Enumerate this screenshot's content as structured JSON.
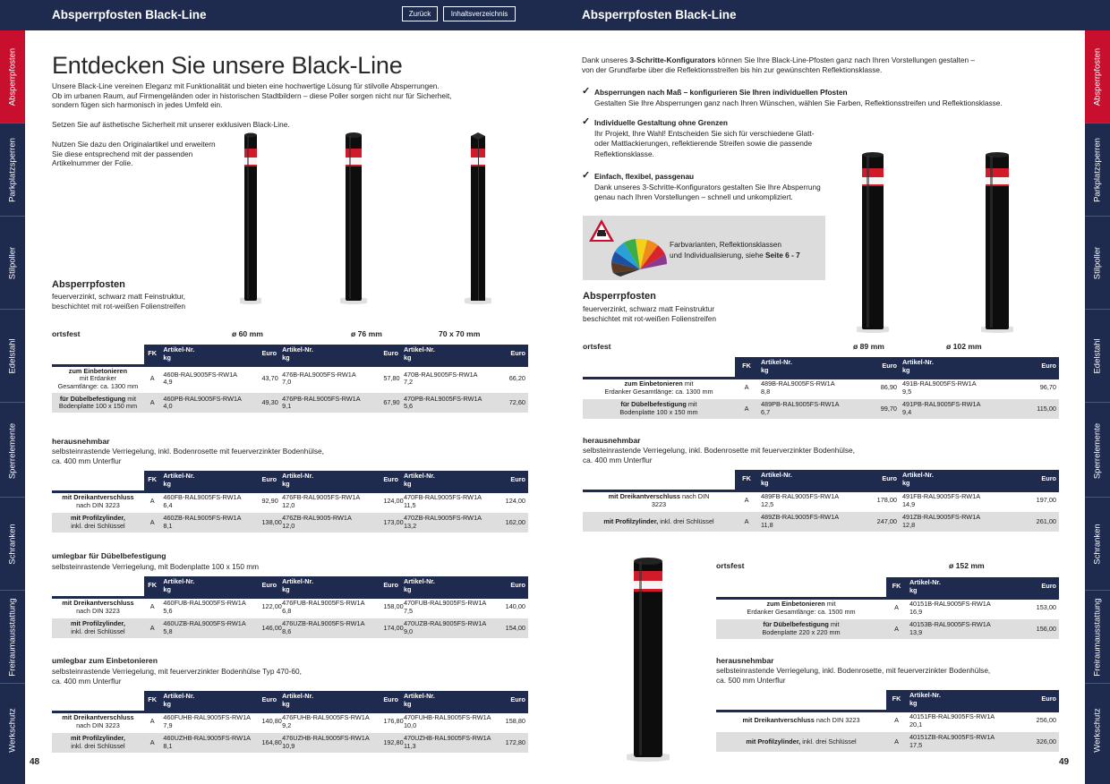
{
  "header": {
    "left_title": "Absperrpfosten Black-Line",
    "right_title": "Absperrpfosten Black-Line",
    "back_label": "Zurück",
    "toc_label": "Inhaltsverzeichnis"
  },
  "nav_tabs": [
    "Absperrpfosten",
    "Parkplatzsperren",
    "Stilpoller",
    "Edelstahl",
    "Sperrelemente",
    "Schranken",
    "Freiraumausstattung",
    "Werkschutz"
  ],
  "colors": {
    "navy": "#1e2a4e",
    "accent_red": "#c8102e"
  },
  "page_numbers": {
    "left": "48",
    "right": "49"
  },
  "left": {
    "headline": "Entdecken Sie unsere Black-Line",
    "intro": [
      "Unsere Black-Line vereinen Eleganz mit Funktionalität und bieten eine hochwertige Lösung für stilvolle Absperrungen.",
      "Ob im urbanen Raum, auf Firmengeländen oder in historischen Stadtbildern – diese Poller sorgen nicht nur für Sicherheit,",
      "sondern fügen sich harmonisch in jedes Umfeld ein."
    ],
    "intro2": "Setzen Sie auf ästhetische Sicherheit mit unserer exklusiven Black-Line.",
    "intro3": [
      "Nutzen Sie dazu den Originalartikel und erweitern",
      "Sie diese entsprechend mit der passenden",
      "Artikelnummer der Folie."
    ],
    "product_title": "Absperrpfosten",
    "product_desc": [
      "feuerverzinkt, schwarz matt Feinstruktur,",
      "beschichtet mit rot-weißen Folienstreifen"
    ],
    "ortsfest": "ortsfest",
    "diameters": [
      "ø 60 mm",
      "ø 76 mm",
      "70 x 70 mm"
    ],
    "herausnehmbar_title": "herausnehmbar",
    "herausnehmbar_desc": [
      "selbsteinrastende Verriegelung, inkl. Bodenrosette mit feuerverzinkter Bodenhülse,",
      "ca. 400 mm Unterflur"
    ],
    "umlegbar_dub_title": "umlegbar für Dübelbefestigung",
    "umlegbar_dub_desc": [
      "selbsteinrastende Verriegelung, mit Bodenplatte 100 x 150 mm"
    ],
    "umlegbar_bet_title": "umlegbar zum Einbetonieren",
    "umlegbar_bet_desc": [
      "selbsteinrastende Verriegelung, mit feuerverzinkter Bodenhülse Typ 470-60,",
      "ca. 400 mm Unterflur"
    ]
  },
  "right": {
    "intro": [
      "Dank unseres ",
      "3-Schritte-Konfigurators",
      " können Sie Ihre Black-Line-Pfosten ganz nach Ihren Vorstellungen gestalten –",
      "von der Grundfarbe über die Reflektionsstreifen bis hin zur gewünschten Reflektionsklasse."
    ],
    "checks": [
      {
        "title": "Absperrungen nach Maß – konfigurieren Sie Ihren individuellen Pfosten",
        "body": [
          "Gestalten Sie Ihre Absperrungen ganz nach Ihren Wünschen, wählen Sie Farben, Reflektionsstreifen und Reflektionsklasse."
        ]
      },
      {
        "title": "Individuelle Gestaltung ohne Grenzen",
        "body": [
          "Ihr Projekt, Ihre Wahl! Entscheiden Sie sich für verschiedene Glatt-",
          "oder Mattlackierungen, reflektierende Streifen sowie die passende",
          "Reflektionsklasse."
        ]
      },
      {
        "title": "Einfach, flexibel, passgenau",
        "body": [
          "Dank unseres 3-Schritte-Konfigurators gestalten Sie Ihre Absperrung",
          "genau nach Ihren Vorstellungen – schnell und unkompliziert."
        ]
      }
    ],
    "farb_line1": "Farbvarianten, Reflektionsklassen",
    "farb_line2a": "und Individualisierung, siehe ",
    "farb_line2b": "Seite 6 - 7",
    "product_title": "Absperrpfosten",
    "product_desc": [
      "feuerverzinkt, schwarz matt Feinstruktur",
      "beschichtet mit rot-weißen Folienstreifen"
    ],
    "ortsfest": "ortsfest",
    "diameters": [
      "ø 89 mm",
      "ø 102 mm"
    ],
    "herausnehmbar_title": "herausnehmbar",
    "herausnehmbar_desc": [
      "selbsteinrastende Verriegelung, inkl. Bodenrosette mit feuerverzinkter Bodenhülse,",
      "ca. 400 mm Unterflur"
    ],
    "ortsfest2": "ortsfest",
    "diameter152": "ø 152 mm",
    "herausnehmbar2_title": "herausnehmbar",
    "herausnehmbar2_desc": [
      "selbsteinrastende Verriegelung, inkl. Bodenrosette, mit feuerverzinkter Bodenhülse,",
      "ca. 500 mm Unterflur"
    ]
  },
  "table_headers": {
    "fk": "FK",
    "art": [
      "Artikel-Nr.",
      "kg"
    ],
    "euro": "Euro"
  },
  "tables": {
    "t1": [
      {
        "label": [
          [
            "b",
            "zum Einbetonieren"
          ],
          [
            "br"
          ],
          [
            "n",
            "mit Erdanker"
          ],
          [
            "br"
          ],
          [
            "n",
            "Gesamtlänge: ca. 1300 mm"
          ]
        ],
        "fk": "A",
        "cells": [
          [
            "460B-RAL9005FS-RW1A",
            "4,9",
            "43,70"
          ],
          [
            "476B-RAL9005FS-RW1A",
            "7,0",
            "57,80"
          ],
          [
            "470B-RAL9005FS-RW1A",
            "7,2",
            "66,20"
          ]
        ]
      },
      {
        "label": [
          [
            "b",
            "für Dübelbefestigung"
          ],
          [
            "n",
            " mit"
          ],
          [
            "br"
          ],
          [
            "n",
            "Bodenplatte 100 x 150 mm"
          ]
        ],
        "fk": "A",
        "cells": [
          [
            "460PB-RAL9005FS-RW1A",
            "4,0",
            "49,30"
          ],
          [
            "476PB-RAL9005FS-RW1A",
            "9,1",
            "67,90"
          ],
          [
            "470PB-RAL9005FS-RW1A",
            "5,6",
            "72,60"
          ]
        ]
      }
    ],
    "t2": [
      {
        "label": [
          [
            "b",
            "mit Dreikantverschluss"
          ],
          [
            "br"
          ],
          [
            "n",
            "nach DIN 3223"
          ]
        ],
        "fk": "A",
        "cells": [
          [
            "460FB-RAL9005FS-RW1A",
            "6,4",
            "92,90"
          ],
          [
            "476FB-RAL9005FS-RW1A",
            "12,0",
            "124,00"
          ],
          [
            "470FB-RAL9005FS-RW1A",
            "11,5",
            "124,00"
          ]
        ]
      },
      {
        "label": [
          [
            "b",
            "mit Profilzylinder,"
          ],
          [
            "br"
          ],
          [
            "n",
            "inkl. drei Schlüssel"
          ]
        ],
        "fk": "A",
        "cells": [
          [
            "460ZB-RAL9005FS-RW1A",
            "8,1",
            "138,00"
          ],
          [
            "476ZB-RAL9005-RW1A",
            "12,0",
            "173,00"
          ],
          [
            "470ZB-RAL9005FS-RW1A",
            "13,2",
            "162,00"
          ]
        ]
      }
    ],
    "t3": [
      {
        "label": [
          [
            "b",
            "mit Dreikantverschluss"
          ],
          [
            "br"
          ],
          [
            "n",
            "nach DIN 3223"
          ]
        ],
        "fk": "A",
        "cells": [
          [
            "460FUB-RAL9005FS-RW1A",
            "5,6",
            "122,00"
          ],
          [
            "476FUB-RAL9005FS-RW1A",
            "6,8",
            "158,00"
          ],
          [
            "470FUB-RAL9005FS-RW1A",
            "7,5",
            "140,00"
          ]
        ]
      },
      {
        "label": [
          [
            "b",
            "mit Profilzylinder,"
          ],
          [
            "br"
          ],
          [
            "n",
            "inkl. drei Schlüssel"
          ]
        ],
        "fk": "A",
        "cells": [
          [
            "460UZB-RAL9005FS-RW1A",
            "5,8",
            "146,00"
          ],
          [
            "476UZB-RAL9005FS-RW1A",
            "8,6",
            "174,00"
          ],
          [
            "470UZB-RAL9005FS-RW1A",
            "9,0",
            "154,00"
          ]
        ]
      }
    ],
    "t4": [
      {
        "label": [
          [
            "b",
            "mit Dreikantverschluss"
          ],
          [
            "br"
          ],
          [
            "n",
            "nach DIN 3223"
          ]
        ],
        "fk": "A",
        "cells": [
          [
            "460FUHB-RAL9005FS-RW1A",
            "7,9",
            "140,80"
          ],
          [
            "476FUHB-RAL9005FS-RW1A",
            "9,2",
            "176,80"
          ],
          [
            "470FUHB-RAL9005FS-RW1A",
            "10,0",
            "158,80"
          ]
        ]
      },
      {
        "label": [
          [
            "b",
            "mit Profilzylinder,"
          ],
          [
            "br"
          ],
          [
            "n",
            "inkl. drei Schlüssel"
          ]
        ],
        "fk": "A",
        "cells": [
          [
            "460UZHB-RAL9005FS-RW1A",
            "8,1",
            "164,80"
          ],
          [
            "476UZHB-RAL9005FS-RW1A",
            "10,9",
            "192,80"
          ],
          [
            "470UZHB-RAL9005FS-RW1A",
            "11,3",
            "172,80"
          ]
        ]
      }
    ],
    "t5": [
      {
        "label": [
          [
            "b",
            "zum Einbetonieren"
          ],
          [
            "n",
            " mit"
          ],
          [
            "br"
          ],
          [
            "n",
            "Erdanker Gesamtlänge: ca. 1300 mm"
          ]
        ],
        "fk": "A",
        "cells": [
          [
            "489B-RAL9005FS-RW1A",
            "8,8",
            "86,90"
          ],
          [
            "491B-RAL9005FS-RW1A",
            "9,5",
            "96,70"
          ]
        ]
      },
      {
        "label": [
          [
            "b",
            "für Dübelbefestigung"
          ],
          [
            "n",
            " mit"
          ],
          [
            "br"
          ],
          [
            "n",
            "Bodenplatte 100 x 150 mm"
          ]
        ],
        "fk": "A",
        "cells": [
          [
            "489PB-RAL9005FS-RW1A",
            "6,7",
            "99,70"
          ],
          [
            "491PB-RAL9005FS-RW1A",
            "9,4",
            "115,00"
          ]
        ]
      }
    ],
    "t6": [
      {
        "label": [
          [
            "b",
            "mit Dreikantverschluss"
          ],
          [
            "n",
            " nach DIN"
          ],
          [
            "br"
          ],
          [
            "n",
            "3223"
          ]
        ],
        "fk": "A",
        "cells": [
          [
            "489FB-RAL9005FS-RW1A",
            "12,5",
            "178,00"
          ],
          [
            "491FB-RAL9005FS-RW1A",
            "14,9",
            "197,00"
          ]
        ]
      },
      {
        "label": [
          [
            "b",
            "mit Profilzylinder,"
          ],
          [
            "n",
            " inkl. drei Schlüssel"
          ]
        ],
        "fk": "A",
        "cells": [
          [
            "489ZB-RAL9005FS-RW1A",
            "11,8",
            "247,00"
          ],
          [
            "491ZB-RAL9005FS-RW1A",
            "12,8",
            "261,00"
          ]
        ]
      }
    ],
    "t7": [
      {
        "label": [
          [
            "b",
            "zum Einbetonieren"
          ],
          [
            "n",
            " mit"
          ],
          [
            "br"
          ],
          [
            "n",
            "Erdanker Gesamtlänge: ca. 1500 mm"
          ]
        ],
        "fk": "A",
        "cells": [
          [
            "40151B-RAL9005FS-RW1A",
            "16,9",
            "153,00"
          ]
        ]
      },
      {
        "label": [
          [
            "b",
            "für Dübelbefestigung"
          ],
          [
            "n",
            " mit"
          ],
          [
            "br"
          ],
          [
            "n",
            "Bodenplatte 220 x 220 mm"
          ]
        ],
        "fk": "A",
        "cells": [
          [
            "40153B-RAL9005FS-RW1A",
            "13,9",
            "156,00"
          ]
        ]
      }
    ],
    "t8": [
      {
        "label": [
          [
            "b",
            "mit Dreikantverschluss"
          ],
          [
            "n",
            " nach DIN 3223"
          ]
        ],
        "fk": "A",
        "cells": [
          [
            "40151FB-RAL9005FS-RW1A",
            "20,1",
            "256,00"
          ]
        ]
      },
      {
        "label": [
          [
            "b",
            "mit Profilzylinder,"
          ],
          [
            "n",
            " inkl. drei Schlüssel"
          ]
        ],
        "fk": "A",
        "cells": [
          [
            "40151ZB-RAL9005FS-RW1A",
            "17,5",
            "326,00"
          ]
        ]
      }
    ]
  }
}
